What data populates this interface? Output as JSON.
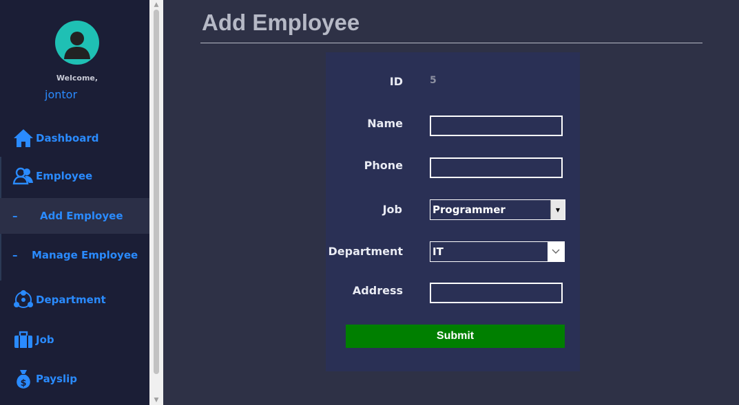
{
  "sidebar": {
    "welcome": "Welcome,",
    "username": "jontor",
    "items": [
      {
        "label": "Dashboard",
        "icon": "home-icon"
      },
      {
        "label": "Employee",
        "icon": "users-icon"
      },
      {
        "label": "Add Employee",
        "icon": "dash",
        "active": true
      },
      {
        "label": "Manage Employee",
        "icon": "dash"
      },
      {
        "label": "Department",
        "icon": "department-icon"
      },
      {
        "label": "Job",
        "icon": "briefcase-icon"
      },
      {
        "label": "Payslip",
        "icon": "money-bag-icon"
      }
    ]
  },
  "page": {
    "title": "Add Employee"
  },
  "form": {
    "id_label": "ID",
    "id_value": "5",
    "name_label": "Name",
    "name_value": "",
    "phone_label": "Phone",
    "phone_value": "",
    "job_label": "Job",
    "job_value": "Programmer",
    "department_label": "Department",
    "department_value": "IT",
    "address_label": "Address",
    "address_value": "",
    "submit_label": "Submit"
  },
  "colors": {
    "sidebar_bg": "#1b1e36",
    "main_bg": "#2e3146",
    "panel_bg": "#2a3055",
    "accent_blue": "#2a8bff",
    "submit_green": "#007f00",
    "avatar_teal": "#1fc0b4"
  }
}
